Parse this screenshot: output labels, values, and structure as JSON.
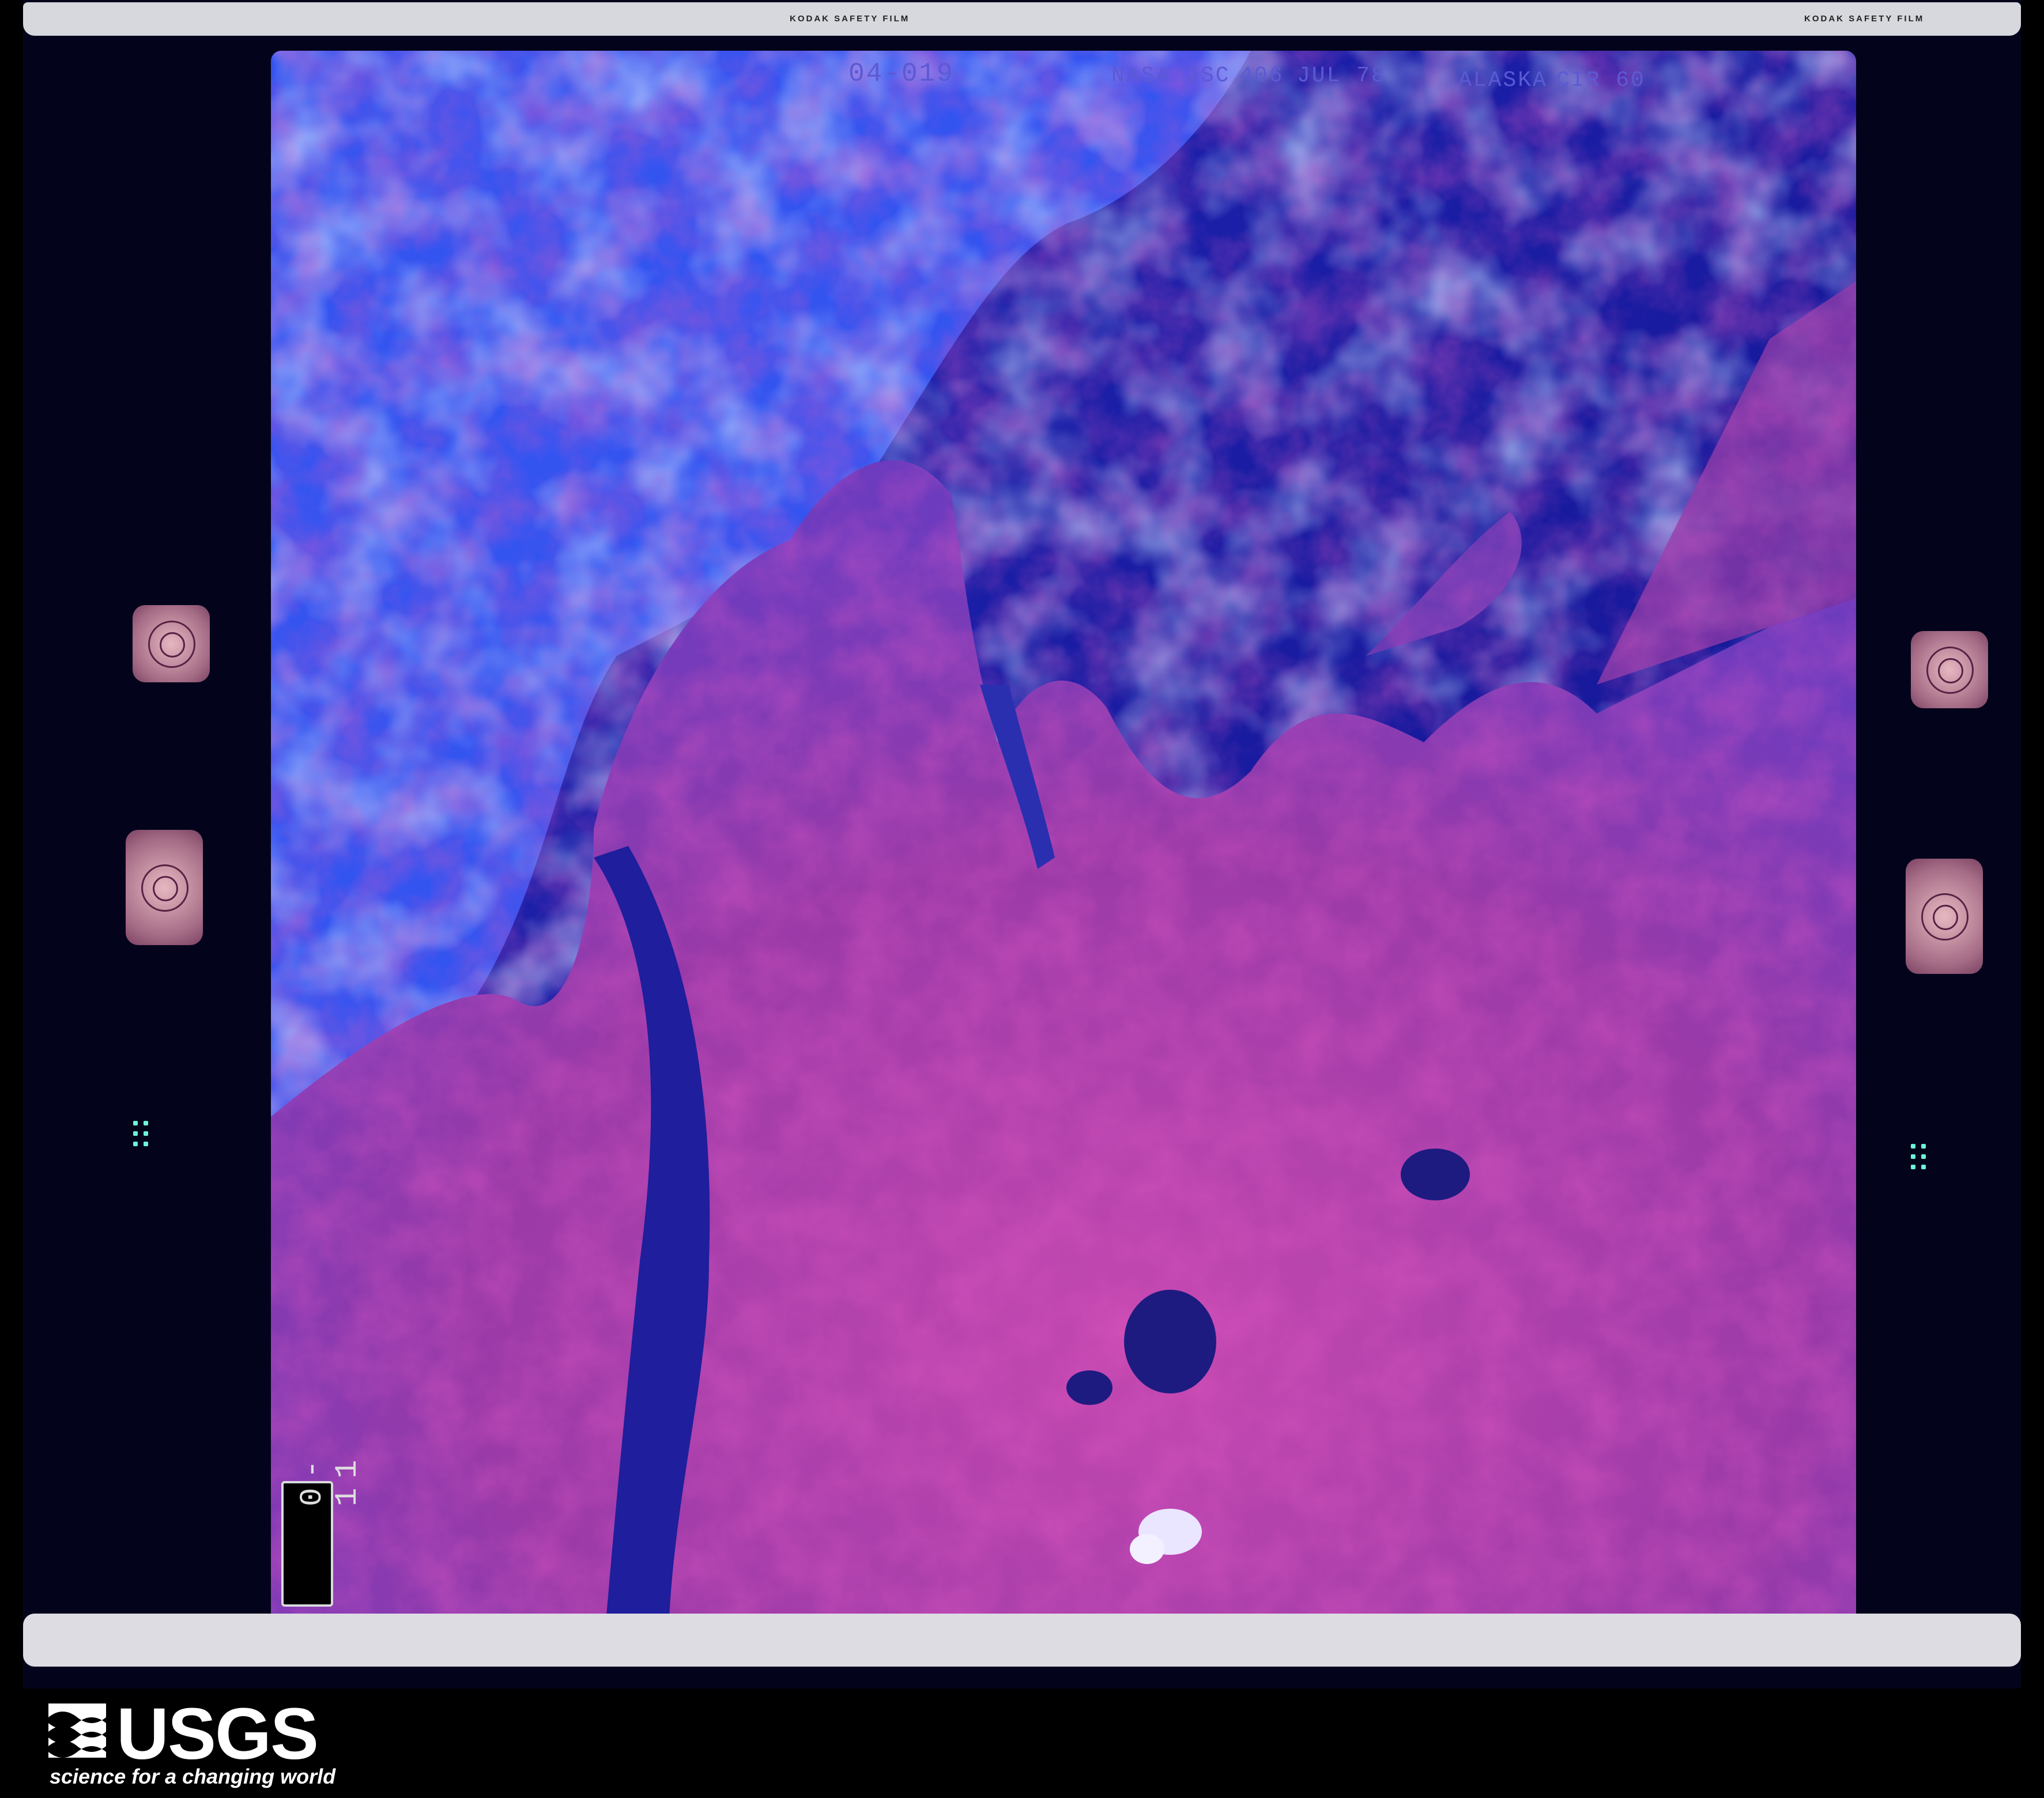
{
  "frame": {
    "roll_frame": "04-019",
    "agency": "NASA JSC",
    "format": "406",
    "date": "JUL 78",
    "location": "ALASKA",
    "extra": "CIR 60",
    "edge_print": "KODAK SAFETY FILM",
    "side_tab": "0-11"
  },
  "usgs": {
    "wordmark": "USGS",
    "tagline": "science for a changing world"
  },
  "colors": {
    "background": "#000000",
    "water": "#1c1a9a",
    "land": "#b63ea6",
    "cloud": "#5f8cff",
    "film_base": "#03041c"
  }
}
